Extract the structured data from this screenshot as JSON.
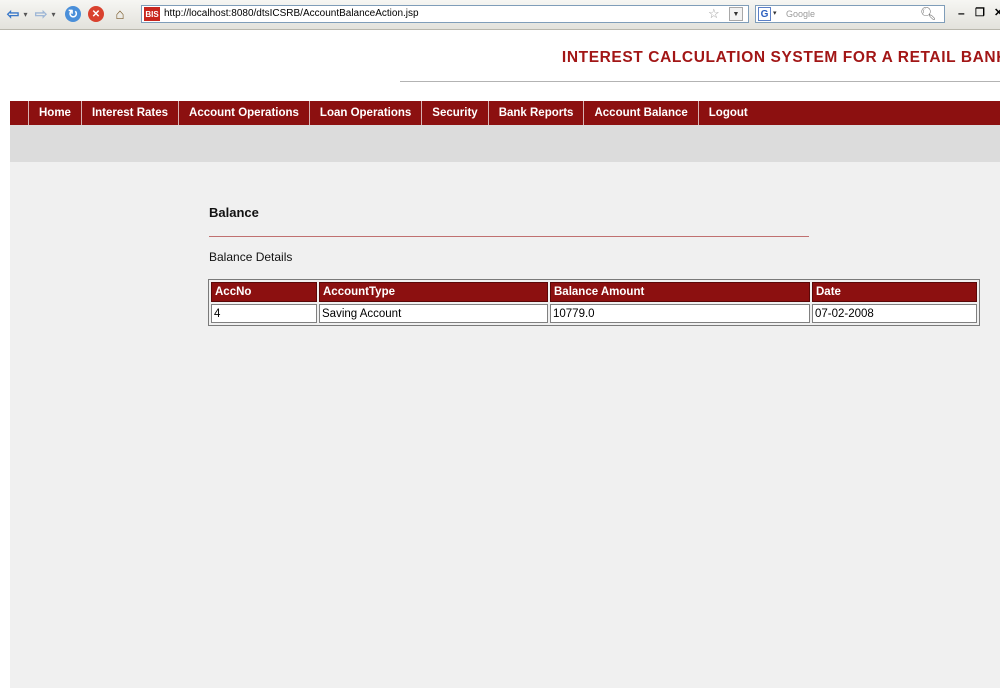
{
  "browser": {
    "url": "http://localhost:8080/dtsICSRB/AccountBalanceAction.jsp",
    "site_badge": "BIS",
    "search_placeholder": "Google",
    "icons": [
      "back-icon",
      "forward-icon",
      "reload-icon",
      "stop-icon",
      "home-icon",
      "star-icon",
      "search-icon"
    ]
  },
  "header": {
    "title": "INTEREST CALCULATION SYSTEM FOR A RETAIL BANK",
    "title_color": "#a21616"
  },
  "nav": {
    "items": [
      {
        "label": "Home"
      },
      {
        "label": "Interest Rates"
      },
      {
        "label": "Account Operations"
      },
      {
        "label": "Loan Operations"
      },
      {
        "label": "Security"
      },
      {
        "label": "Bank Reports"
      },
      {
        "label": "Account Balance"
      },
      {
        "label": "Logout"
      }
    ],
    "bg_color": "#8c1010"
  },
  "main": {
    "heading": "Balance",
    "subheading": "Balance Details",
    "table": {
      "headers": [
        "AccNo",
        "AccountType",
        "Balance Amount",
        "Date"
      ],
      "rows": [
        [
          "4",
          "Saving Account",
          "10779.0",
          "07-02-2008"
        ]
      ]
    }
  }
}
